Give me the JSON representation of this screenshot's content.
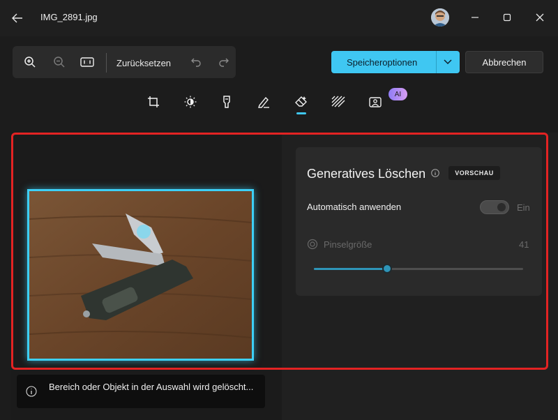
{
  "window": {
    "file_name": "IMG_2891.jpg"
  },
  "toolbar": {
    "reset_label": "Zurücksetzen",
    "save_label": "Speicheroptionen",
    "cancel_label": "Abbrechen"
  },
  "tabs": {
    "active": "erase",
    "ai_badge": "AI",
    "icons": [
      "crop-icon",
      "brightness-icon",
      "filter-icon",
      "markup-icon",
      "erase-icon",
      "background-icon",
      "generative-icon"
    ]
  },
  "panel": {
    "title": "Generatives Löschen",
    "preview_badge": "VORSCHAU",
    "auto_apply_label": "Automatisch anwenden",
    "auto_apply_state": "Ein",
    "brush_size_label": "Pinselgröße",
    "brush_size_value": "41",
    "brush_size_fraction": 0.35
  },
  "toast": {
    "message": "Bereich oder Objekt in der Auswahl wird gelöscht..."
  },
  "colors": {
    "accent": "#3fc7f2",
    "highlight_frame": "#e32323",
    "ai_badge_start": "#8f7cf5",
    "ai_badge_end": "#d89ef2"
  }
}
